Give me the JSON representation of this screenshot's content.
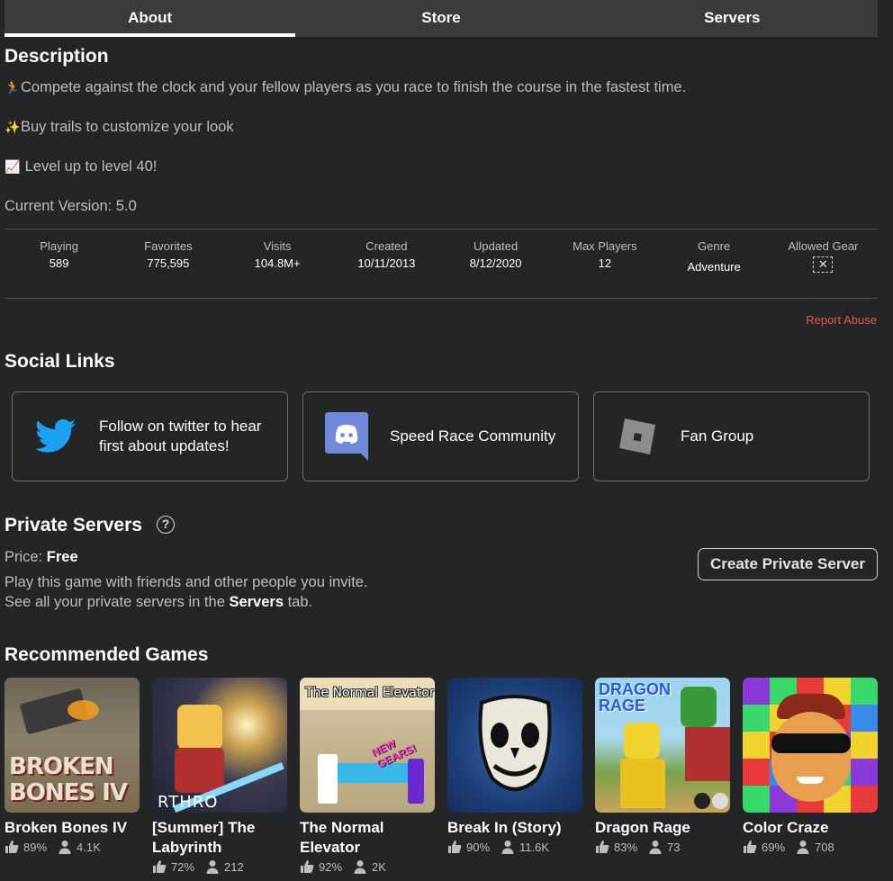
{
  "tabs": [
    "About",
    "Store",
    "Servers"
  ],
  "description": {
    "title": "Description",
    "lines": [
      "Compete against the clock and your fellow players as you race to finish the course in the fastest time.",
      "Buy trails to customize your look",
      "Level up to level 40!",
      "Current Version: 5.0"
    ],
    "emoji": [
      "🏃",
      "✨",
      "📈"
    ]
  },
  "stats": [
    {
      "label": "Playing",
      "value": "589"
    },
    {
      "label": "Favorites",
      "value": "775,595"
    },
    {
      "label": "Visits",
      "value": "104.8M+"
    },
    {
      "label": "Created",
      "value": "10/11/2013"
    },
    {
      "label": "Updated",
      "value": "8/12/2020"
    },
    {
      "label": "Max Players",
      "value": "12"
    },
    {
      "label": "Genre",
      "value": "Adventure"
    },
    {
      "label": "Allowed Gear",
      "value": "✕"
    }
  ],
  "report_abuse": "Report Abuse",
  "social": {
    "title": "Social Links",
    "links": [
      {
        "text": "Follow on twitter to hear first about updates!",
        "icon": "twitter-icon"
      },
      {
        "text": "Speed Race Community",
        "icon": "discord-icon"
      },
      {
        "text": "Fan Group",
        "icon": "roblox-group-icon"
      }
    ]
  },
  "private_servers": {
    "title": "Private Servers",
    "price_label": "Price:",
    "price_value": "Free",
    "line1": "Play this game with friends and other people you invite.",
    "line2_a": "See all your private servers in the ",
    "line2_b": "Servers",
    "line2_c": " tab.",
    "create_button": "Create Private Server"
  },
  "recommended": {
    "title": "Recommended Games",
    "games": [
      {
        "name": "Broken Bones IV",
        "rating": "89%",
        "players": "4.1K",
        "thumb_text": "BROKEN BONES IV"
      },
      {
        "name": "[Summer] The Labyrinth",
        "rating": "72%",
        "players": "212",
        "thumb_text": "RTHRO"
      },
      {
        "name": "The Normal Elevator",
        "rating": "92%",
        "players": "2K",
        "thumb_text": "The Normal Elevator",
        "thumb_text2": "NEW GEARS!"
      },
      {
        "name": "Break In (Story)",
        "rating": "90%",
        "players": "11.6K"
      },
      {
        "name": "Dragon Rage",
        "rating": "83%",
        "players": "73",
        "thumb_text": "DRAGON RAGE"
      },
      {
        "name": "Color Craze",
        "rating": "69%",
        "players": "708"
      }
    ]
  },
  "colors": {
    "background": "#232527",
    "accent_red": "#e2584b",
    "twitter": "#1da1f2",
    "discord": "#7289da"
  }
}
